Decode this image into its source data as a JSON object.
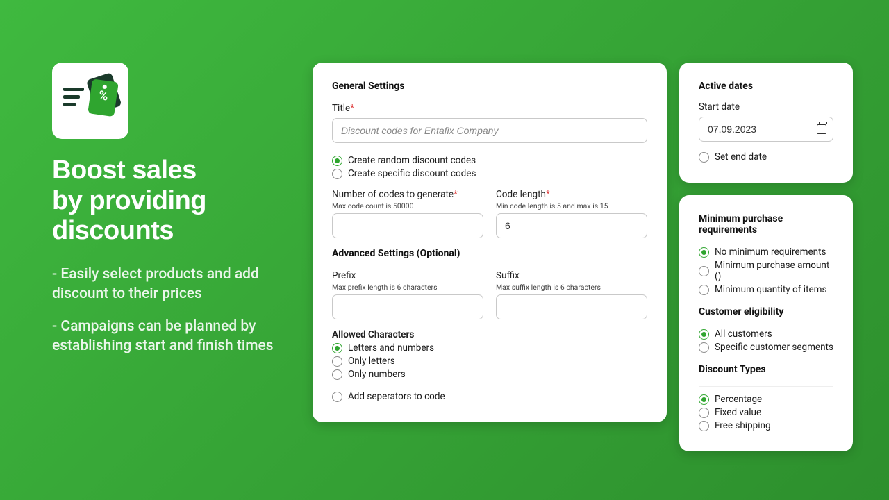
{
  "hero": {
    "headline": "Boost sales\nby providing discounts",
    "bullets": [
      "- Easily select products and add discount to their prices",
      "- Campaigns can be planned by establishing start and finish times"
    ]
  },
  "general": {
    "heading": "General Settings",
    "title_label": "Title",
    "title_placeholder": "Discount codes for Entafix Company",
    "title_value": "",
    "create_random": "Create random discount codes",
    "create_specific": "Create specific discount codes",
    "num_codes_label": "Number of codes to generate",
    "num_codes_hint": "Max code count is 50000",
    "num_codes_value": "",
    "code_length_label": "Code length",
    "code_length_hint": "Min code length is 5 and max is 15",
    "code_length_value": "6"
  },
  "advanced": {
    "heading": "Advanced Settings (Optional)",
    "prefix_label": "Prefix",
    "prefix_hint": "Max prefix length is 6 characters",
    "suffix_label": "Suffix",
    "suffix_hint": "Max suffix length is 6 characters",
    "allowed_heading": "Allowed Characters",
    "opt_letters_numbers": "Letters and numbers",
    "opt_only_letters": "Only letters",
    "opt_only_numbers": "Only numbers",
    "add_separators": "Add seperators to code"
  },
  "dates": {
    "heading": "Active dates",
    "start_label": "Start date",
    "start_value": "07.09.2023",
    "set_end": "Set end date"
  },
  "purchase": {
    "heading": "Minimum purchase requirements",
    "opt_none": "No minimum requirements",
    "opt_amount": "Minimum purchase amount ()",
    "opt_qty": "Minimum quantity of items"
  },
  "eligibility": {
    "heading": "Customer eligibility",
    "opt_all": "All customers",
    "opt_segments": "Specific customer segments"
  },
  "discount_types": {
    "heading": "Discount Types",
    "opt_percentage": "Percentage",
    "opt_fixed": "Fixed value",
    "opt_free_ship": "Free shipping"
  }
}
